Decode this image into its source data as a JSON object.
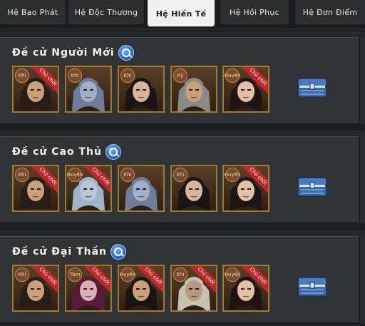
{
  "tabs": [
    {
      "label": "Hệ Bạo Phát",
      "active": false
    },
    {
      "label": "Hệ Độc Thương",
      "active": false
    },
    {
      "label": "Hệ Hiến Tế",
      "active": true
    },
    {
      "label": "Hệ Hồi Phục",
      "active": false
    },
    {
      "label": "Hệ Đơn Điểm",
      "active": false
    }
  ],
  "sections": [
    {
      "title": "Đề cử Người Mới",
      "heroes": [
        {
          "badge": "Khí",
          "ribbon": "Chủ chốt",
          "skin": "#c9a07a",
          "hair": "#2a1d16"
        },
        {
          "badge": "Khí",
          "ribbon": "",
          "skin": "#9fb0c8",
          "hair": "#6f7d9a"
        },
        {
          "badge": "Khí",
          "ribbon": "",
          "skin": "#d8b49a",
          "hair": "#1b1414"
        },
        {
          "badge": "Kỳ",
          "ribbon": "",
          "skin": "#c9a07a",
          "hair": "#8a8a8a"
        },
        {
          "badge": "Huyền",
          "ribbon": "Chủ chốt",
          "skin": "#e2c0a8",
          "hair": "#1e1414"
        }
      ]
    },
    {
      "title": "Đề cử Cao Thủ",
      "heroes": [
        {
          "badge": "Khí",
          "ribbon": "Chủ chốt",
          "skin": "#c9a07a",
          "hair": "#2a1d16"
        },
        {
          "badge": "Huyền",
          "ribbon": "Chủ chốt",
          "skin": "#b8c8d8",
          "hair": "#9fb4c8"
        },
        {
          "badge": "Khí",
          "ribbon": "",
          "skin": "#9fb0c8",
          "hair": "#6f7d9a"
        },
        {
          "badge": "Khí",
          "ribbon": "",
          "skin": "#d8b49a",
          "hair": "#1b1414"
        },
        {
          "badge": "Huyền",
          "ribbon": "Chủ chốt",
          "skin": "#e2c0a8",
          "hair": "#1e1414"
        }
      ]
    },
    {
      "title": "Đề cử Đại Thần",
      "heroes": [
        {
          "badge": "Khí",
          "ribbon": "Chủ chốt",
          "skin": "#c9a07a",
          "hair": "#2a1d16"
        },
        {
          "badge": "Tâm",
          "ribbon": "Chủ chốt",
          "skin": "#d8b0b8",
          "hair": "#5a1a3a"
        },
        {
          "badge": "Huyền",
          "ribbon": "Chủ chốt",
          "skin": "#c9a07a",
          "hair": "#1a1410"
        },
        {
          "badge": "Khí",
          "ribbon": "Chủ chốt",
          "skin": "#b89a80",
          "hair": "#c8c0b0"
        },
        {
          "badge": "Huyền",
          "ribbon": "Chủ chốt",
          "skin": "#e2c0a8",
          "hair": "#1e1414"
        }
      ]
    }
  ],
  "colors": {
    "frame": "#a07a2e",
    "ribbon": "#c0262a",
    "chest": "#3d6aa8"
  },
  "icons": {
    "search": "magnifier-icon",
    "chest": "treasure-chest-icon"
  }
}
